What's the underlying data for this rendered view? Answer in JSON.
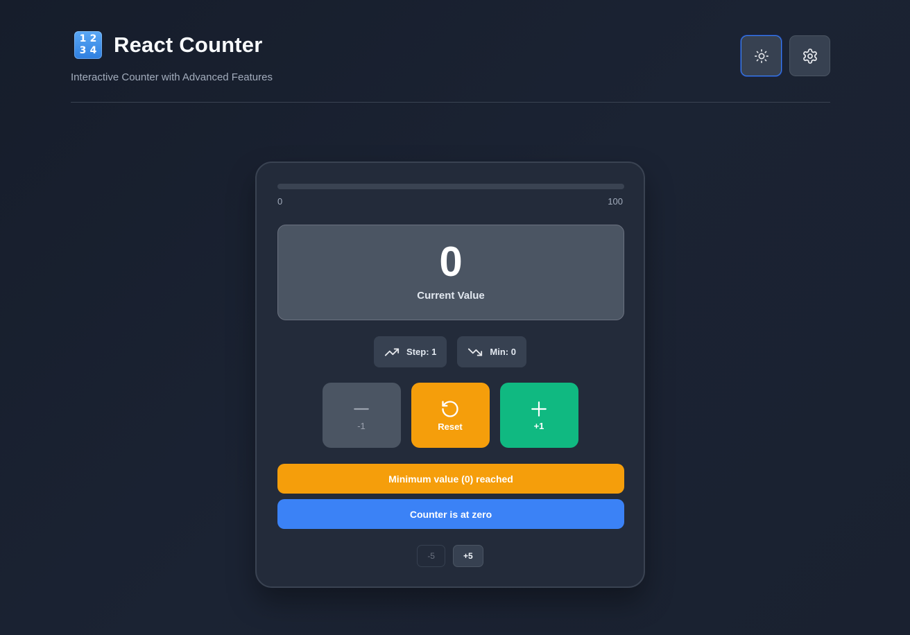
{
  "header": {
    "logo_digits": [
      "1",
      "2",
      "3",
      "4"
    ],
    "title": "React Counter",
    "subtitle": "Interactive Counter with Advanced Features",
    "theme_icon": "sun-icon",
    "settings_icon": "gear-icon"
  },
  "counter": {
    "progress": {
      "min_label": "0",
      "max_label": "100",
      "fraction": 0.0
    },
    "value": "0",
    "value_label": "Current Value",
    "step_chip": {
      "icon": "trending-up-icon",
      "label": "Step: 1"
    },
    "min_chip": {
      "icon": "trending-down-icon",
      "label": "Min: 0"
    },
    "buttons": {
      "decrement": {
        "icon": "minus-icon",
        "label": "-1",
        "disabled": true
      },
      "reset": {
        "icon": "rotate-ccw-icon",
        "label": "Reset"
      },
      "increment": {
        "icon": "plus-icon",
        "label": "+1"
      }
    },
    "alerts": {
      "warning": "Minimum value (0) reached",
      "info": "Counter is at zero"
    },
    "quick": {
      "minus5": "-5",
      "plus5": "+5"
    }
  },
  "colors": {
    "accent_blue": "#3b82f6",
    "reset_orange": "#f59e0b",
    "increment_green": "#10b981"
  }
}
